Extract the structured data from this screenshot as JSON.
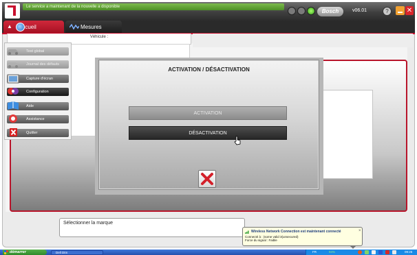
{
  "header": {
    "banner_text": "Le service a maintenant de la nouvelle a disponible",
    "brand_badge": "Bosch",
    "version": "v06.01",
    "help_label": "?",
    "close_glyph": "✕"
  },
  "tabs": [
    {
      "label": "Accueil",
      "active": true
    },
    {
      "label": "Mesures",
      "active": false
    }
  ],
  "vehicle_label": "Véhicule :",
  "sidebar": {
    "items": [
      {
        "label": "Test global",
        "state": "disabled"
      },
      {
        "label": "Journal des défauts",
        "state": "disabled"
      },
      {
        "label": "Capture d'écran",
        "state": "normal"
      },
      {
        "label": "Configuration",
        "state": "active"
      },
      {
        "label": "Aide",
        "state": "normal"
      },
      {
        "label": "Assistance",
        "state": "normal"
      },
      {
        "label": "Quitter",
        "state": "normal"
      }
    ]
  },
  "modal": {
    "title": "ACTIVATION / DÉSACTIVATION",
    "activation_label": "ACTIVATION",
    "desactivation_label": "DÉSACTIVATION"
  },
  "brand_field": {
    "placeholder": "Sélectionner la marque"
  },
  "balloon": {
    "title": "Wireless Network Connection est maintenant connecté",
    "line1": "Connecté à : (some valid 3(unsecured)",
    "line2": "Force du signal : Faible",
    "close_glyph": "×"
  },
  "taskbar": {
    "start_label": "démarrer",
    "task_item": "Dell Dtm",
    "lang": "FR",
    "battery": "94%",
    "clock": "09:26"
  },
  "colors": {
    "accent_red": "#c8102e",
    "header_dark": "#2c2c2c",
    "taskbar_blue": "#2550ad",
    "balloon_bg": "#ffffe1"
  }
}
